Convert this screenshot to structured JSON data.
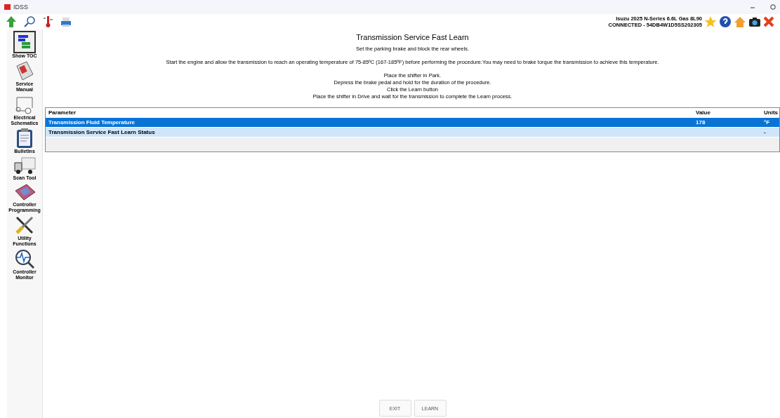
{
  "window": {
    "title": "IDSS"
  },
  "vehicle": {
    "model": "Isuzu 2025 N-Series 6.6L Gas 8L90",
    "connection": "CONNECTED - 54DB4W1D5SS202305"
  },
  "sidebar": {
    "items": [
      {
        "label": "Show TOC",
        "kind": "toc"
      },
      {
        "label": "Service Manual",
        "kind": "manual"
      },
      {
        "label": "Electrical Schematics",
        "kind": "schematic"
      },
      {
        "label": "Bulletins",
        "kind": "bulletin"
      },
      {
        "label": "Scan Tool",
        "kind": "truck"
      },
      {
        "label": "Controller Programming",
        "kind": "ecu"
      },
      {
        "label": "Utility Functions",
        "kind": "tools"
      },
      {
        "label": "Controller Monitor",
        "kind": "monitor"
      }
    ]
  },
  "procedure": {
    "title": "Transmission Service Fast Learn",
    "paragraphs": [
      [
        "Set the parking brake and block the rear wheels."
      ],
      [
        "Start the engine and allow the transmission to reach an operating temperature of 75-85ºC (167-185ºF) before performing the procedure.You may need to brake torque the transmission to achieve this temperature."
      ],
      [
        "Place the shifter in Park.",
        "Depress the brake pedal and hold for the duration of the procedure.",
        "Click the Learn button",
        "Place the shifter in Drive and wait for the transmission to complete the Learn process."
      ]
    ]
  },
  "table": {
    "columns": [
      "Parameter",
      "Value",
      "Units"
    ],
    "rows": [
      {
        "parameter": "Transmission Fluid Temperature",
        "value": "178",
        "units": "°F",
        "selected": true
      },
      {
        "parameter": "Transmission Service Fast Learn Status",
        "value": "",
        "units": "-",
        "selected": false
      }
    ]
  },
  "buttons": [
    {
      "label": "EXIT"
    },
    {
      "label": "LEARN"
    }
  ]
}
